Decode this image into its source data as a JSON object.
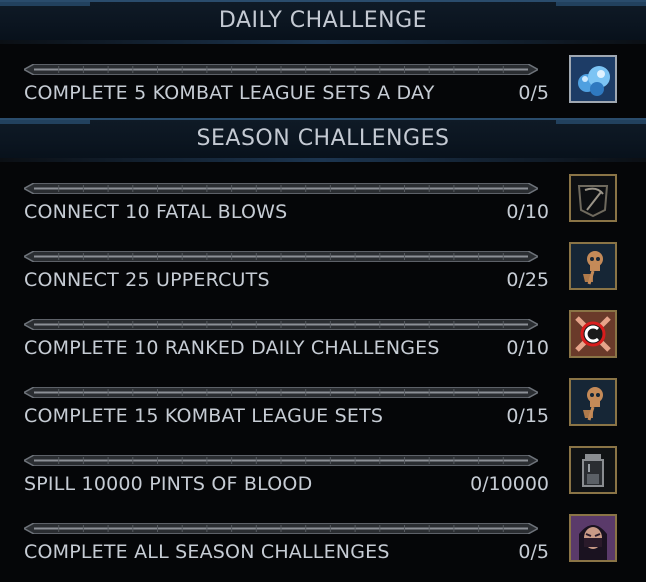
{
  "daily": {
    "title": "DAILY CHALLENGE",
    "items": [
      {
        "label": "COMPLETE 5 KOMBAT LEAGUE SETS A DAY",
        "count": "0/5",
        "progress": 0,
        "icon": "koins-bag-icon"
      }
    ]
  },
  "season": {
    "title": "SEASON CHALLENGES",
    "items": [
      {
        "label": "CONNECT 10 FATAL BLOWS",
        "count": "0/10",
        "progress": 0,
        "icon": "scythe-icon"
      },
      {
        "label": "CONNECT 25 UPPERCUTS",
        "count": "0/25",
        "progress": 0,
        "icon": "skull-fist-icon"
      },
      {
        "label": "COMPLETE 10 RANKED DAILY CHALLENGES",
        "count": "0/10",
        "progress": 0,
        "icon": "ranked-challenge-icon"
      },
      {
        "label": "COMPLETE 15 KOMBAT LEAGUE SETS",
        "count": "0/15",
        "progress": 0,
        "icon": "skull-fist-icon"
      },
      {
        "label": "SPILL 10000 PINTS OF BLOOD",
        "count": "0/10000",
        "progress": 0,
        "icon": "blood-vial-icon"
      },
      {
        "label": "COMPLETE ALL SEASON CHALLENGES",
        "count": "0/5",
        "progress": 0,
        "icon": "fighter-portrait-icon"
      }
    ]
  },
  "colors": {
    "header_bg": "#0b1520",
    "header_accent": "#2a4c6c",
    "text": "#c6ccd4",
    "icon_frame": "#8a7446",
    "bar_track": "#6e737a"
  }
}
